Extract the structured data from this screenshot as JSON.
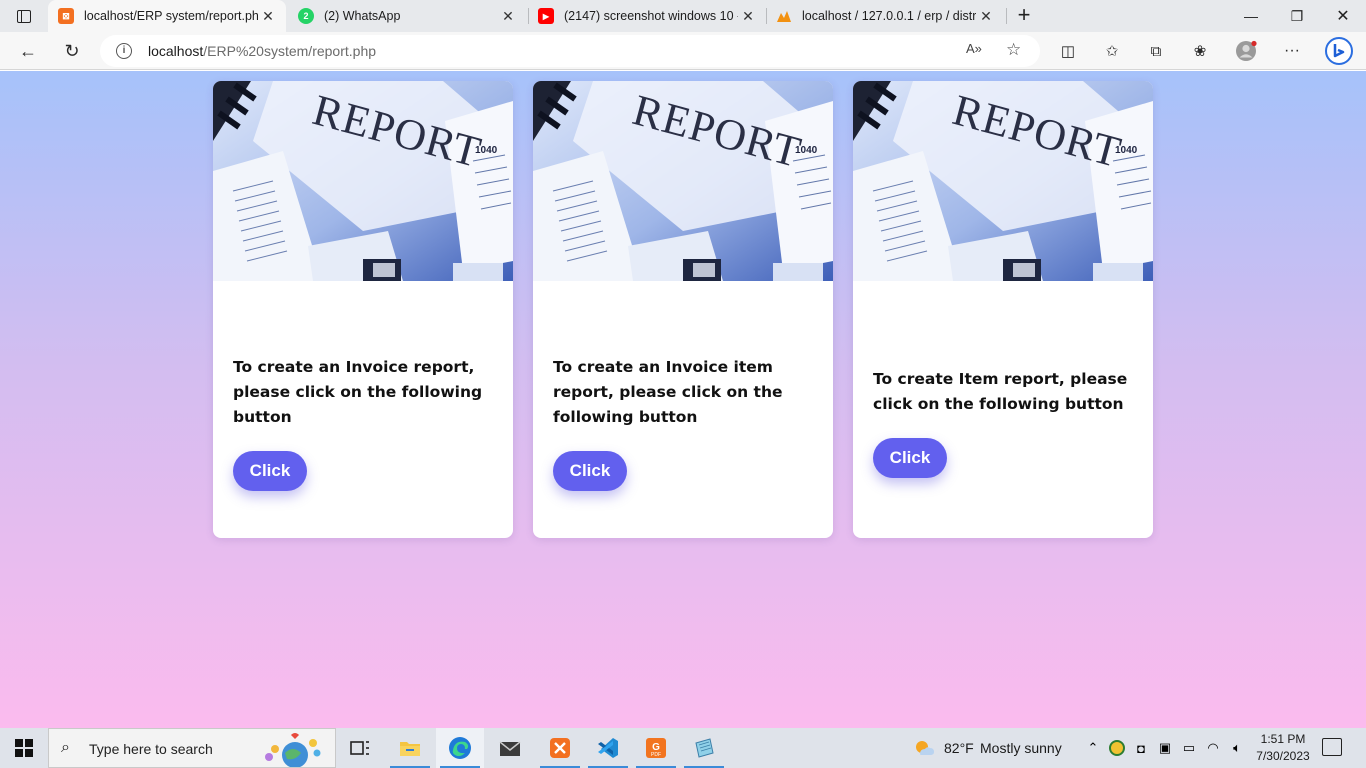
{
  "browser": {
    "tabs": [
      {
        "title": "localhost/ERP system/report.php",
        "active": true
      },
      {
        "title": "(2) WhatsApp",
        "badge": "2"
      },
      {
        "title": "(2147) screenshot windows 10 - Y"
      },
      {
        "title": "localhost / 127.0.0.1 / erp / distri"
      }
    ],
    "address": {
      "host": "localhost",
      "path": "/ERP%20system/report.php"
    }
  },
  "cards": [
    {
      "image_word": "REPORT",
      "text": "To create an Invoice report, please click on the following button",
      "button": "Click"
    },
    {
      "image_word": "REPORT",
      "text": "To create an Invoice item report, please click on the following button",
      "button": "Click"
    },
    {
      "image_word": "REPORT",
      "text": "To create Item report, please click on the following button",
      "button": "Click"
    }
  ],
  "taskbar": {
    "search_placeholder": "Type here to search",
    "weather": {
      "temp": "82°F",
      "condition": "Mostly sunny"
    },
    "clock": {
      "time": "1:51 PM",
      "date": "7/30/2023"
    }
  },
  "colors": {
    "button": "#6260ee",
    "gradient_top": "#a6c2fa",
    "gradient_bottom": "#fbbbee"
  }
}
